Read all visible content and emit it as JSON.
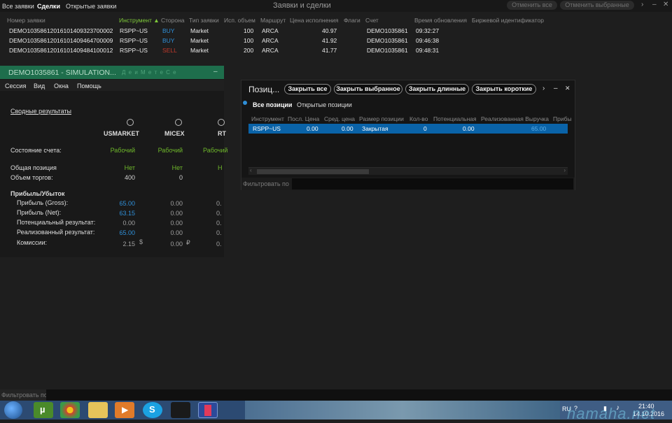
{
  "topbar": {
    "tabs": [
      "Все заявки",
      "Сделки",
      "Открытые заявки"
    ],
    "title": "Заявки и сделки",
    "cancel_all": "Отменить все",
    "cancel_selected": "Отменить выбранные",
    "ctl_menu": "›",
    "ctl_min": "–",
    "ctl_close": "✕"
  },
  "orders": {
    "columns": [
      "Номер заявки",
      "Инструмент ▲",
      "Сторона",
      "Тип заявки",
      "Исп. объем",
      "Маршрут",
      "Цена исполнения",
      "Флаги",
      "Счет",
      "Время обновления",
      "Биржевой идентификатор"
    ],
    "rows": [
      {
        "id": "DEMO1035861201610140932370000​2",
        "instrument": "RSPP~US",
        "side": "BUY",
        "type": "Market",
        "vol": "100",
        "route": "ARCA",
        "price": "40.97",
        "account": "DEMO1035861",
        "time": "09:32:27"
      },
      {
        "id": "DEMO10358612016101409464700009",
        "instrument": "RSPP~US",
        "side": "BUY",
        "type": "Market",
        "vol": "100",
        "route": "ARCA",
        "price": "41.92",
        "account": "DEMO1035861",
        "time": "09:46:38"
      },
      {
        "id": "DEMO10358612016101409484100012",
        "instrument": "RSPP~US",
        "side": "SELL",
        "type": "Market",
        "vol": "200",
        "route": "ARCA",
        "price": "41.77",
        "account": "DEMO1035861",
        "time": "09:48:31"
      }
    ]
  },
  "account": {
    "title": "DEMO1035861 - SIMULATION...",
    "title_tail": "Д е и М е т е С е",
    "menu": [
      "Сессия",
      "Вид",
      "Окна",
      "Помощь"
    ],
    "summary_link": "Сводные результаты",
    "markets": [
      "USMARKET",
      "MICEX",
      "RT"
    ],
    "state_label": "Состояние счета:",
    "state_values": [
      "Рабочий",
      "Рабочий",
      "Рабочий"
    ],
    "position_label": "Общая позиция",
    "position_values": [
      "Нет",
      "Нет",
      "Н"
    ],
    "volume_label": "Объем торгов:",
    "volume_values": [
      "400",
      "0",
      ""
    ],
    "pnl_header": "Прибыль/Убыток",
    "gross_label": "Прибыль (Gross):",
    "gross_values": [
      "65.00",
      "0.00",
      "0."
    ],
    "net_label": "Прибыль (Net):",
    "net_values": [
      "63.15",
      "0.00",
      "0."
    ],
    "potential_label": "Потенциальный результат:",
    "potential_values": [
      "0.00",
      "0.00",
      "0."
    ],
    "realized_label": "Реализованный результат:",
    "realized_values": [
      "65.00",
      "0.00",
      "0."
    ],
    "fees_label": "Комиссии:",
    "fees_values": [
      "2.15",
      "0.00",
      "0."
    ],
    "currency_usd": "$",
    "currency_rub": "₽"
  },
  "positions": {
    "title": "Позиц...",
    "buttons": [
      "Закрыть все",
      "Закрыть выбранное",
      "Закрыть длинные",
      "Закрыть короткие"
    ],
    "tabs": [
      "Все позиции",
      "Открытые позиции"
    ],
    "columns": [
      "Инструмент",
      "Посл. Цена",
      "Сред. цена",
      "Размер позиции",
      "Кол-во",
      "Потенциальная",
      "Реализованная Выручка",
      "Прибы"
    ],
    "row": {
      "instrument": "RSPP~US",
      "last": "0.00",
      "avg": "0.00",
      "size": "Закрытая",
      "qty": "0",
      "potential": "0.00",
      "realized": "65.00"
    },
    "filter_label": "Фильтровать по",
    "ctl_more": "›",
    "ctl_min": "–",
    "ctl_close": "✕"
  },
  "bottom": {
    "filter_label": "Фильтровать по"
  },
  "taskbar": {
    "lang": "RU",
    "time": "21:40",
    "date": "14.10.2016",
    "watermark": "hamaha.net"
  }
}
